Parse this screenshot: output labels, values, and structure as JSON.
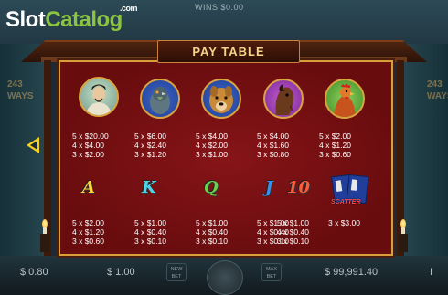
{
  "logo": {
    "part1": "Slot",
    "part2": "Catalog",
    "suffix": ".com"
  },
  "header": {
    "wins_text": "WINS  $0.00"
  },
  "side_text": {
    "left": "243 WAYS",
    "right": "243 WAYS"
  },
  "paytable": {
    "title": "PAY TABLE",
    "symbols_row1": [
      {
        "name": "warrior",
        "icon": "warrior-portrait-icon",
        "pays": "5 x $20.00\n4 x $4.00\n3 x $2.00"
      },
      {
        "name": "pigeon",
        "icon": "pigeon-icon",
        "pays": "5 x $6.00\n4 x $2.40\n3 x $1.20"
      },
      {
        "name": "dog",
        "icon": "dog-icon",
        "pays": "5 x $4.00\n4 x $2.00\n3 x $1.00"
      },
      {
        "name": "horse",
        "icon": "horse-icon",
        "pays": "5 x $4.00\n4 x $1.60\n3 x $0.80"
      },
      {
        "name": "rooster",
        "icon": "rooster-icon",
        "pays": "5 x $2.00\n4 x $1.20\n3 x $0.60"
      }
    ],
    "symbols_row2": [
      {
        "name": "A",
        "glyph": "A",
        "color": "#ffd23a",
        "pays": "5 x $2.00\n4 x $1.20\n3 x $0.60"
      },
      {
        "name": "K",
        "glyph": "K",
        "color": "#4fd3e8",
        "pays": "5 x $1.00\n4 x $0.40\n3 x $0.10"
      },
      {
        "name": "Q",
        "glyph": "Q",
        "color": "#6ad34c",
        "pays": "5 x $1.00\n4 x $0.40\n3 x $0.10"
      },
      {
        "name": "J",
        "glyph": "J",
        "color": "#3a8ef0",
        "pays": "5 x $1.00\n4 x $0.40\n3 x $0.10"
      },
      {
        "name": "10",
        "glyph": "10",
        "color": "#ff5a3a",
        "pays": "5 x $1.00\n4 x $0.40\n3 x $0.10"
      }
    ],
    "scatter": {
      "label": "SCATTER",
      "pays": "3 x $3.00"
    }
  },
  "controls": {
    "bet_left": "$ 0.80",
    "bet_total": "$ 1.00",
    "new_bet": "NEW\nBET",
    "max_bet": "MAX\nBET",
    "balance": "$ 99,991.40",
    "menu": "I"
  },
  "colors": {
    "panel": "#6a0e10",
    "border": "#d89f3a",
    "arrow": "#f3d11c"
  }
}
